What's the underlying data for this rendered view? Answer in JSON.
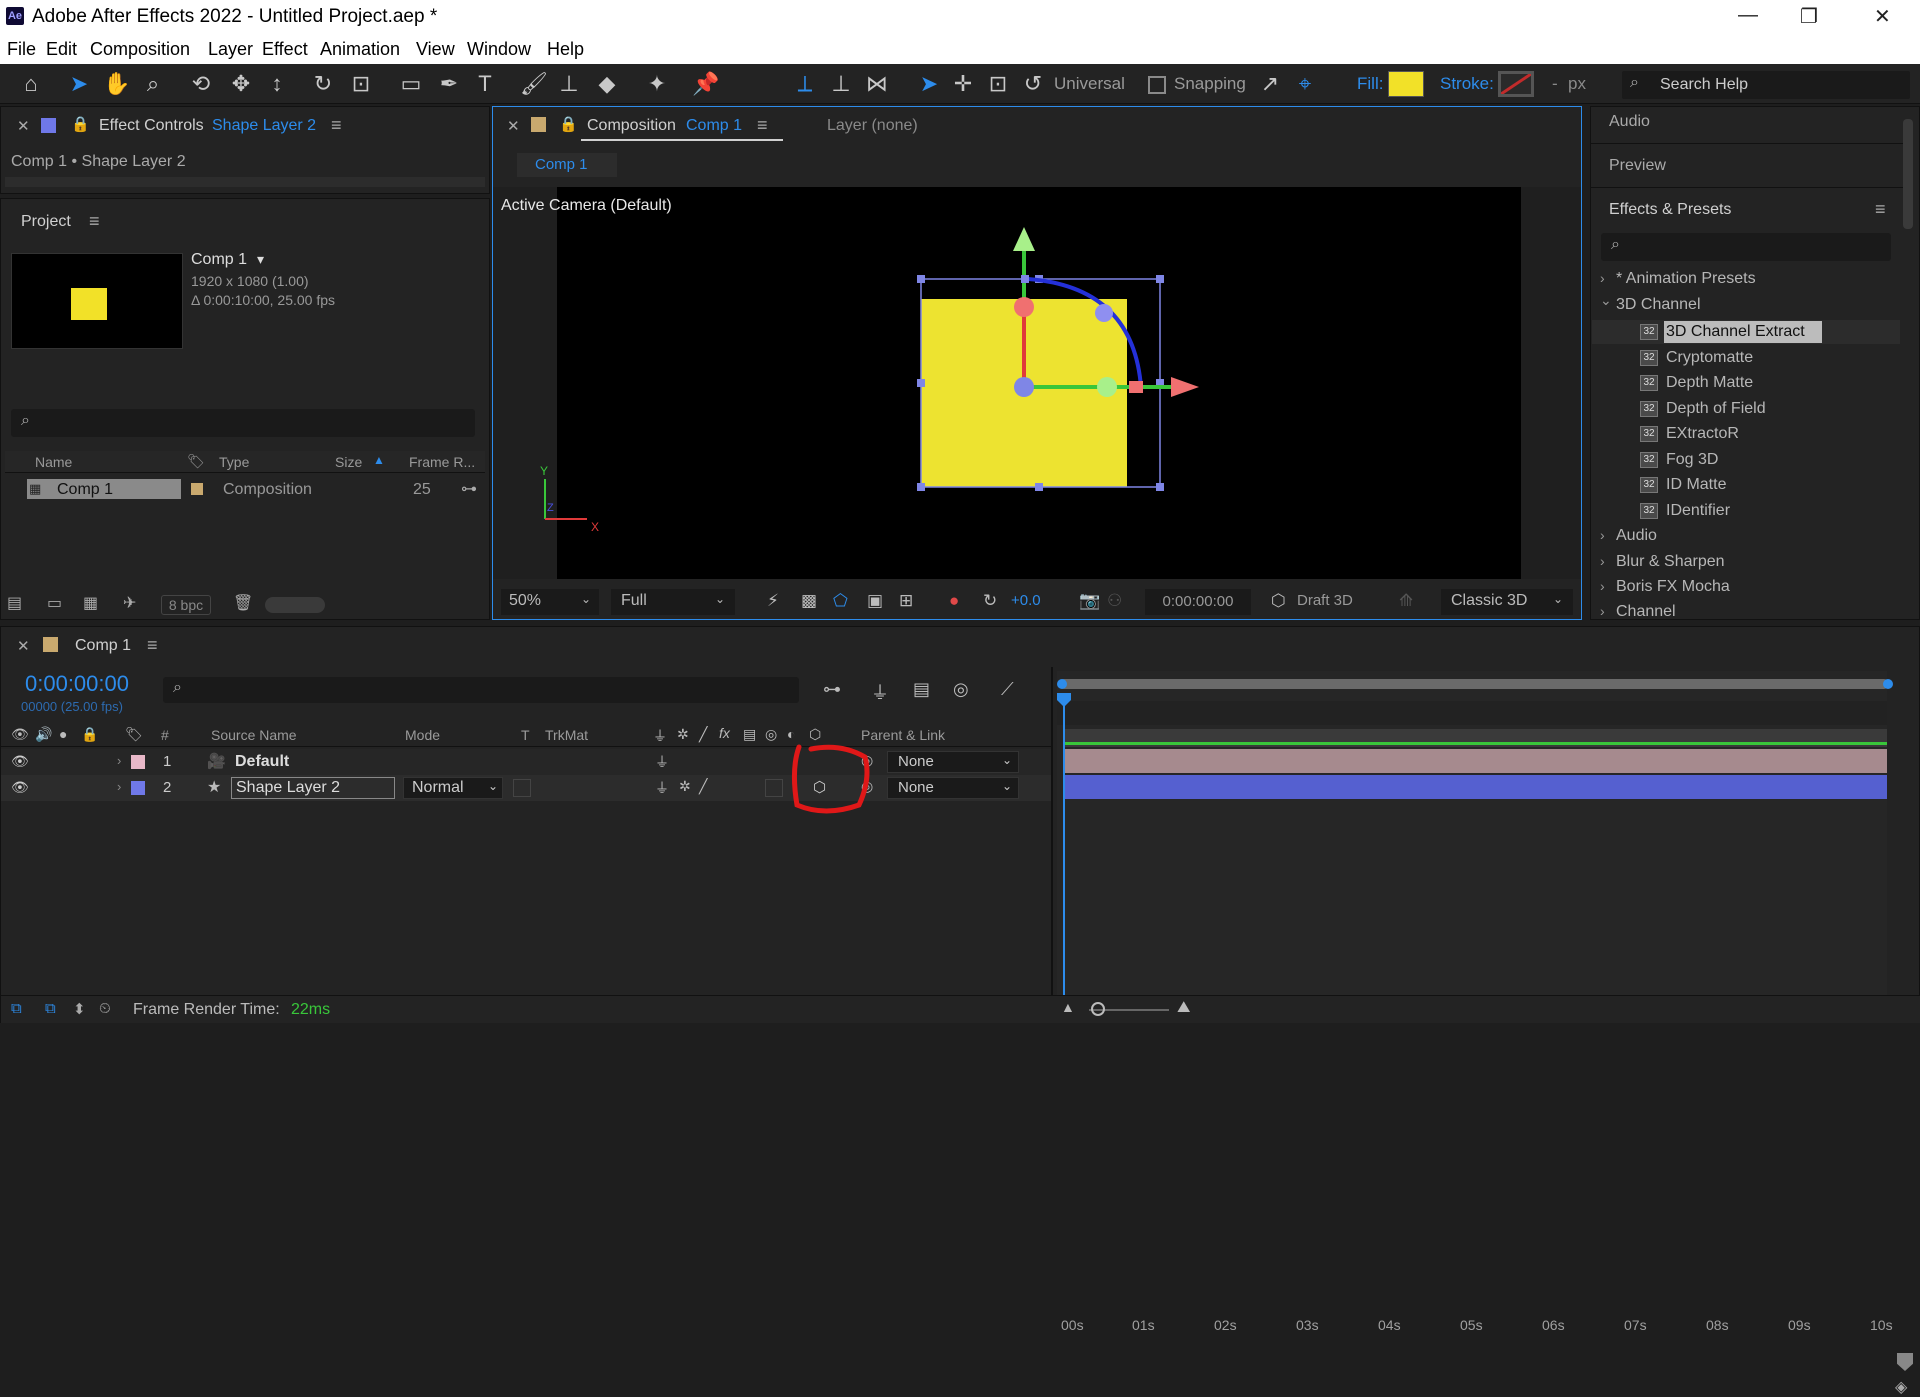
{
  "window": {
    "title": "Adobe After Effects 2022 - Untitled Project.aep *",
    "logo": "Ae",
    "controls": [
      "—",
      "❐",
      "✕"
    ]
  },
  "menu": [
    "File",
    "Edit",
    "Composition",
    "Layer",
    "Effect",
    "Animation",
    "View",
    "Window",
    "Help"
  ],
  "toolbar": {
    "universal_label": "Universal",
    "snapping_label": "Snapping",
    "fill_label": "Fill:",
    "stroke_label": "Stroke:",
    "stroke_value": "-",
    "stroke_unit": "px",
    "search_placeholder": "Search Help",
    "fill_color": "#f2e128",
    "stroke_color": "#c22b2b"
  },
  "effect_controls": {
    "title": "Effect Controls",
    "layer": "Shape Layer 2",
    "subtitle": "Comp 1 • Shape Layer 2"
  },
  "project": {
    "title": "Project",
    "item_name": "Comp 1",
    "item_arrow": "▾",
    "item_dims": "1920 x 1080 (1.00)",
    "item_duration": "Δ 0:00:10:00, 25.00 fps",
    "search_placeholder": "",
    "columns": [
      "Name",
      "Type",
      "Size",
      "Frame R..."
    ],
    "rows": [
      {
        "name": "Comp 1",
        "type": "Composition",
        "fps": "25"
      }
    ],
    "bpc": "8 bpc"
  },
  "composition": {
    "title": "Composition",
    "comp_name": "Comp 1",
    "layer_tab": "Layer (none)",
    "flow_tab": "Comp 1",
    "camera_label": "Active Camera (Default)",
    "zoom": "50%",
    "resolution": "Full",
    "exposure": "+0.0",
    "timecode": "0:00:00:00",
    "renderer_label": "Draft 3D",
    "renderer": "Classic 3D"
  },
  "right_panels": {
    "audio": "Audio",
    "preview": "Preview",
    "effects_presets": "Effects & Presets",
    "tree": [
      {
        "label": "* Animation Presets",
        "level": 0,
        "arrow": "›"
      },
      {
        "label": "3D Channel",
        "level": 0,
        "arrow": "⌄"
      },
      {
        "label": "3D Channel Extract",
        "level": 1,
        "selected": true
      },
      {
        "label": "Cryptomatte",
        "level": 1
      },
      {
        "label": "Depth Matte",
        "level": 1
      },
      {
        "label": "Depth of Field",
        "level": 1
      },
      {
        "label": "EXtractoR",
        "level": 1
      },
      {
        "label": "Fog 3D",
        "level": 1
      },
      {
        "label": "ID Matte",
        "level": 1
      },
      {
        "label": "IDentifier",
        "level": 1
      },
      {
        "label": "Audio",
        "level": 0,
        "arrow": "›"
      },
      {
        "label": "Blur & Sharpen",
        "level": 0,
        "arrow": "›"
      },
      {
        "label": "Boris FX Mocha",
        "level": 0,
        "arrow": "›"
      },
      {
        "label": "Channel",
        "level": 0,
        "arrow": "›"
      }
    ],
    "icon_text": "32"
  },
  "timeline": {
    "comp_tab": "Comp 1",
    "timecode": "0:00:00:00",
    "frame_info": "00000 (25.00 fps)",
    "ruler": [
      "00s",
      "01s",
      "02s",
      "03s",
      "04s",
      "05s",
      "06s",
      "07s",
      "08s",
      "09s",
      "10s"
    ],
    "columns": {
      "num": "#",
      "source": "Source Name",
      "mode": "Mode",
      "t": "T",
      "trkmat": "TrkMat",
      "parent": "Parent & Link"
    },
    "layers": [
      {
        "num": "1",
        "name": "Default",
        "mode": "",
        "parent": "None",
        "label_color": "#e8b8c8"
      },
      {
        "num": "2",
        "name": "Shape Layer 2",
        "mode": "Normal",
        "parent": "None",
        "label_color": "#6f78e8"
      }
    ],
    "frame_render_label": "Frame Render Time:",
    "frame_render_value": "22ms"
  }
}
